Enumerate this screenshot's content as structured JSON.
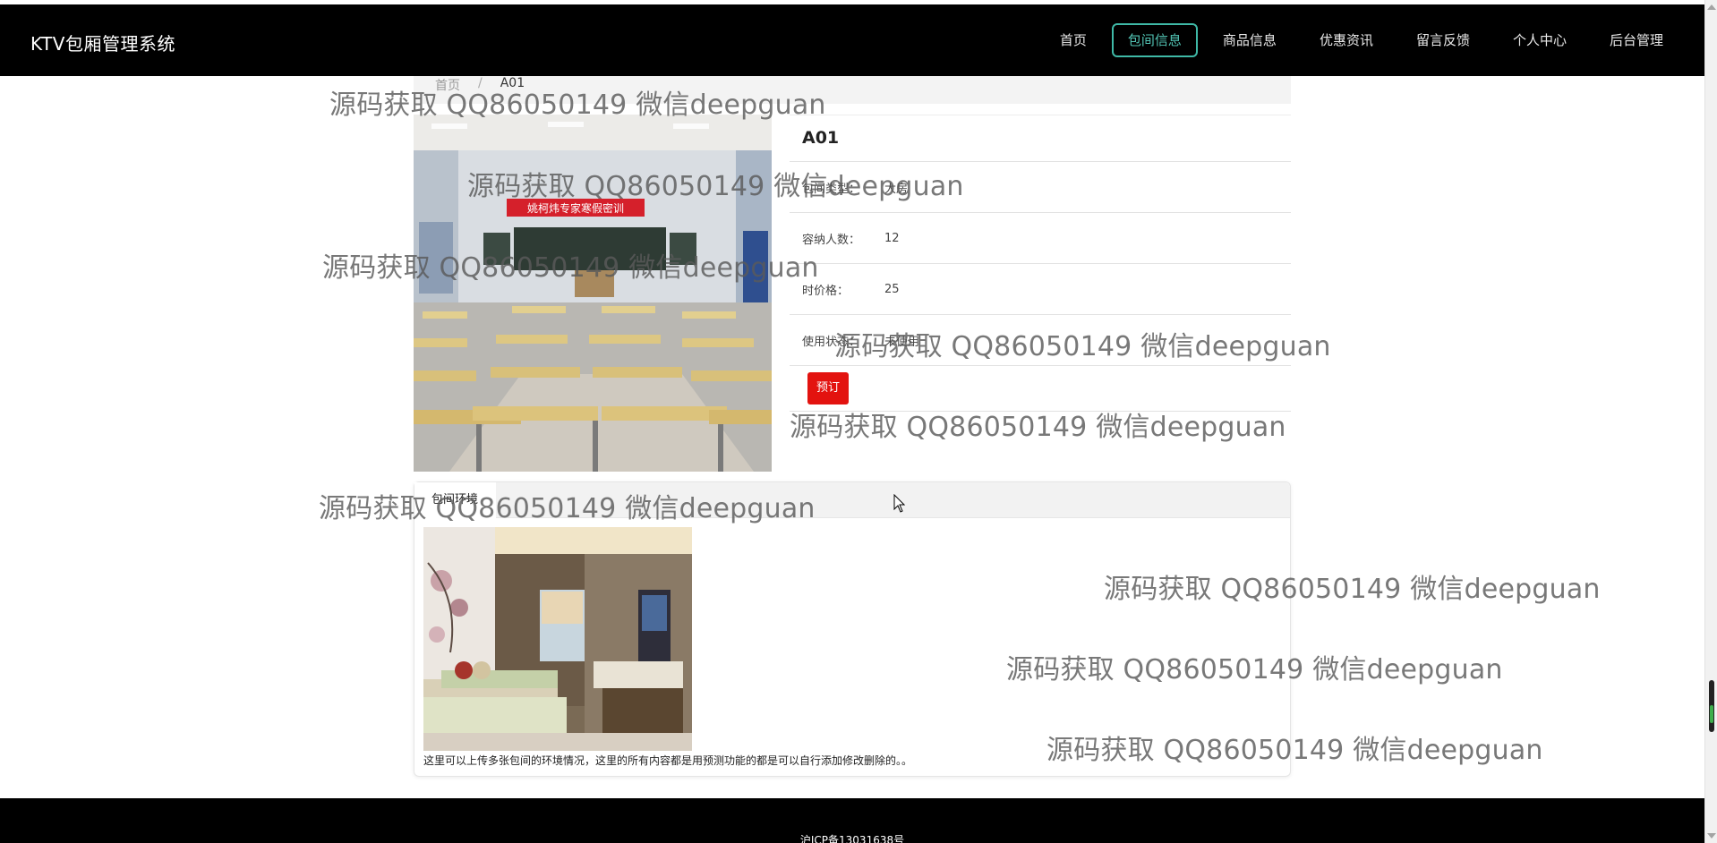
{
  "brand": "KTV包厢管理系统",
  "nav": [
    {
      "label": "首页",
      "active": false
    },
    {
      "label": "包间信息",
      "active": true
    },
    {
      "label": "商品信息",
      "active": false
    },
    {
      "label": "优惠资讯",
      "active": false
    },
    {
      "label": "留言反馈",
      "active": false
    },
    {
      "label": "个人中心",
      "active": false
    },
    {
      "label": "后台管理",
      "active": false
    }
  ],
  "breadcrumb": {
    "home": "首页",
    "separator": "/",
    "current": "A01"
  },
  "room": {
    "name": "A01",
    "fields": [
      {
        "label": "包间类型：",
        "value": "大房"
      },
      {
        "label": "容纳人数：",
        "value": "12"
      },
      {
        "label": "时价格：",
        "value": "25"
      },
      {
        "label": "使用状态：",
        "value": "未使用"
      }
    ],
    "book_label": "预订",
    "photo": "classroom-photo",
    "photo_text": "姚柯炜专家寒假密训"
  },
  "environment": {
    "tab": "包间环境",
    "photo": "hotel-room-photo",
    "description": "这里可以上传多张包间的环境情况，这里的所有内容都是用预测功能的都是可以自行添加修改删除的。。"
  },
  "footer": {
    "icp": "沪ICP备13031638号"
  },
  "watermark": "源码获取 QQ86050149 微信deepguan",
  "colors": {
    "nav_bg": "#000000",
    "accent": "#3fb9a7",
    "book": "#e3130f"
  }
}
